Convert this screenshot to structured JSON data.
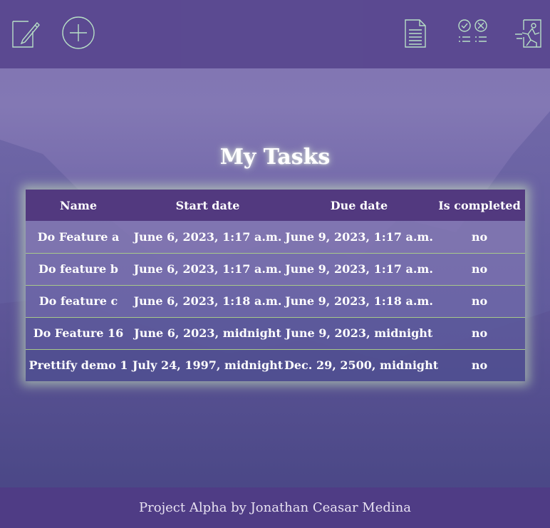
{
  "nav": {
    "icons": [
      "edit-icon",
      "add-circle-icon",
      "document-icon",
      "checklist-icon",
      "logout-runner-icon"
    ]
  },
  "page": {
    "title": "My Tasks"
  },
  "table": {
    "headers": [
      "Name",
      "Start date",
      "Due date",
      "Is completed"
    ],
    "rows": [
      [
        "Do Feature a",
        "June 6, 2023, 1:17 a.m.",
        "June 9, 2023, 1:17 a.m.",
        "no"
      ],
      [
        "Do feature b",
        "June 6, 2023, 1:17 a.m.",
        "June 9, 2023, 1:17 a.m.",
        "no"
      ],
      [
        "Do feature c",
        "June 6, 2023, 1:18 a.m.",
        "June 9, 2023, 1:18 a.m.",
        "no"
      ],
      [
        "Do Feature 16",
        "June 6, 2023, midnight",
        "June 9, 2023, midnight",
        "no"
      ],
      [
        "Prettify demo 1",
        "July 24, 1997, midnight",
        "Dec. 29, 2500, midnight",
        "no"
      ]
    ]
  },
  "footer": {
    "credit": "Project Alpha by Jonathan Ceasar Medina"
  },
  "colors": {
    "header_bar": "#5a4890",
    "table_header": "#52397f",
    "icon_stroke": "#b9e3c7",
    "row_divider": "#a8c98a",
    "footer_bar": "#4f3c85"
  }
}
